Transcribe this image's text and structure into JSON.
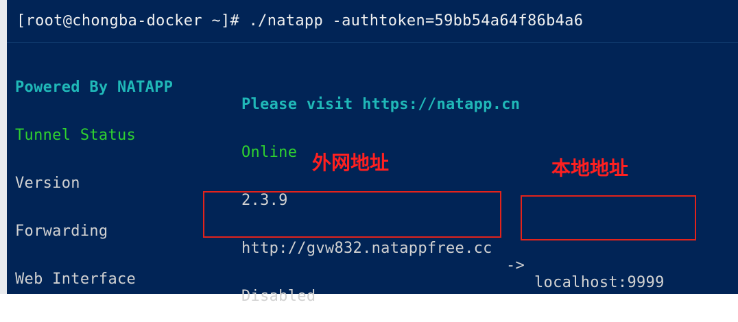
{
  "terminal": {
    "command_line": "[root@chongba-docker ~]# ./natapp -authtoken=59bb54a64f86b4a6",
    "rows": [
      {
        "key": "Powered By NATAPP",
        "value": "Please visit https://natapp.cn"
      },
      {
        "key": "Tunnel Status",
        "value": "Online"
      },
      {
        "key": "Version",
        "value": "2.3.9"
      },
      {
        "key": "Forwarding",
        "value_url": "http://gvw832.natappfree.cc",
        "arrow": "->",
        "value_local": "localhost:9999"
      },
      {
        "key": "Web Interface",
        "value": "Disabled"
      }
    ]
  },
  "annotations": {
    "external_address": "外网地址",
    "local_address": "本地地址"
  },
  "colors": {
    "background": "#012456",
    "powered_row": "#20b8b8",
    "status_row": "#2fd12f",
    "text": "#d2d2d2",
    "annotation": "#e3231b"
  }
}
